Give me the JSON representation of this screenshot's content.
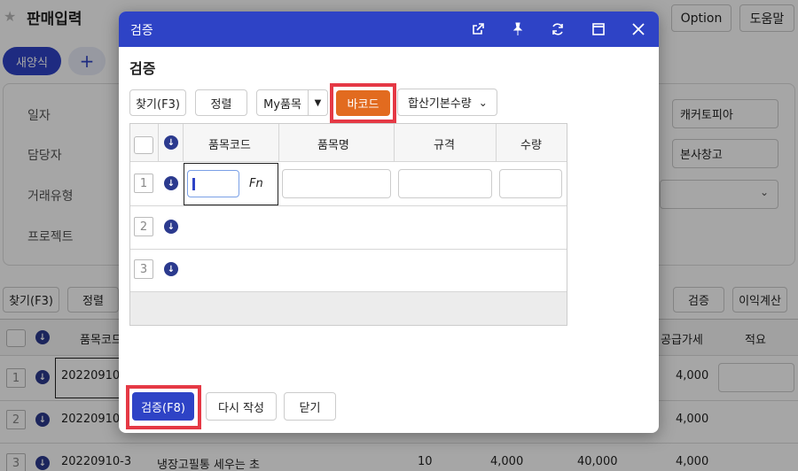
{
  "page": {
    "title": "판매입력",
    "option_label": "Option",
    "help_label": "도움말",
    "new_label": "새양식",
    "add_symbol": "+"
  },
  "form": {
    "labels": [
      "일자",
      "담당자",
      "거래유형",
      "프로젝트"
    ],
    "customer_value": "캐커토피아",
    "warehouse_value": "본사창고"
  },
  "toolbar": {
    "find_label": "찾기(F3)",
    "sort_label": "정렬",
    "verify_label": "검증",
    "profit_label": "이익계산"
  },
  "bg_table": {
    "code_header": "품목코드",
    "supply_header": "공급가세",
    "note_header": "적요",
    "rows": [
      {
        "num": "1",
        "code": "20220910",
        "name": "",
        "qty": "",
        "price": "",
        "amount": "",
        "tax": "4,000"
      },
      {
        "num": "2",
        "code": "20220910",
        "name": "",
        "qty": "",
        "price": "",
        "amount": "",
        "tax": "4,000"
      },
      {
        "num": "3",
        "code": "20220910-3",
        "name": "냉장고필통 세우는 초",
        "qty": "10",
        "price": "4,000",
        "amount": "40,000",
        "tax": "4,000"
      }
    ]
  },
  "dialog": {
    "title": "검증",
    "heading": "검증",
    "find_label": "찾기(F3)",
    "sort_label": "정렬",
    "my_items_label": "My품목",
    "barcode_label": "바코드",
    "qty_mode_label": "합산기본수량",
    "headers": {
      "code": "품목코드",
      "name": "품목명",
      "spec": "규격",
      "qty": "수량"
    },
    "rows": [
      "1",
      "2",
      "3"
    ],
    "fn_label": "Fn",
    "verify_f8_label": "검증(F8)",
    "rewrite_label": "다시 작성",
    "close_label": "닫기"
  },
  "colors": {
    "header_blue": "#2e43c6",
    "barcode_orange": "#e26b1f",
    "highlight_red": "#e53945"
  }
}
